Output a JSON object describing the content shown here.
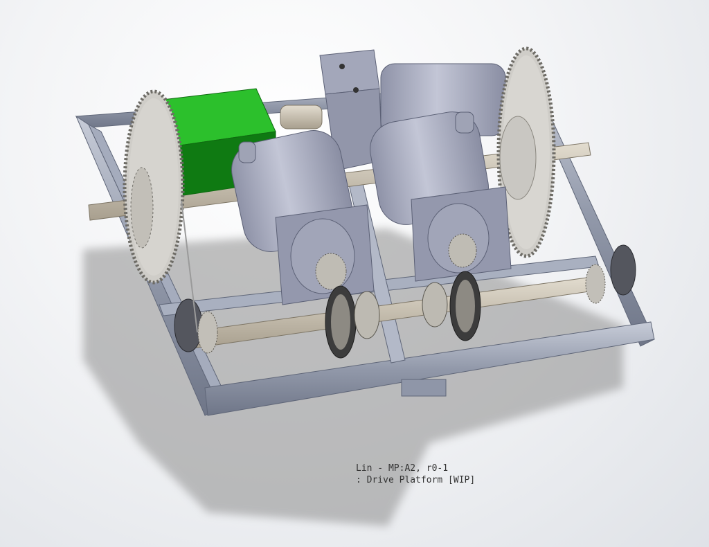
{
  "caption": {
    "line1": "Lin - MP:A2, r0-1",
    "line2": ": Drive Platform [WIP]"
  },
  "colors": {
    "background": "#f3f4f6",
    "frame_aluminum": "#9aa3b5",
    "motor_body": "#a7abbe",
    "battery_green": "#19a81c",
    "sprocket": "#c9c8c4",
    "shaft": "#c7c0b2",
    "shadow": "#8e8e8e"
  },
  "parts": [
    "aluminum-extrusion-frame",
    "drive-motor-left",
    "drive-motor-right",
    "gearbox-motor-rear",
    "battery-box",
    "sprocket-large-left",
    "sprocket-large-right",
    "drive-shaft-front",
    "drive-shaft-rear",
    "omni-wheel-left",
    "omni-wheel-right",
    "pillow-block-bearings"
  ]
}
